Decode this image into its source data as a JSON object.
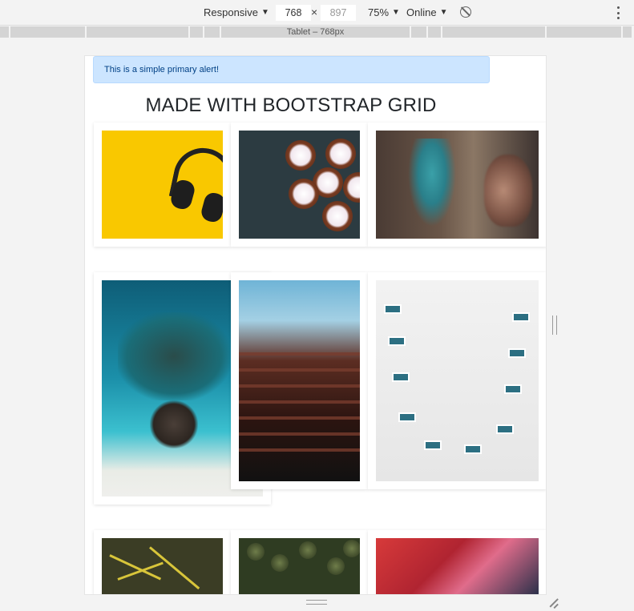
{
  "toolbar": {
    "device": "Responsive",
    "width": "768",
    "height": "897",
    "zoom": "75%",
    "network": "Online"
  },
  "mediaQuery": {
    "label": "Tablet – 768px"
  },
  "page": {
    "alert": "This is a simple primary alert!",
    "heading": "MADE WITH BOOTSTRAP GRID"
  },
  "gallery": [
    {
      "subject": "headphones"
    },
    {
      "subject": "cupcakes"
    },
    {
      "subject": "graffiti"
    },
    {
      "subject": "ocean"
    },
    {
      "subject": "tower"
    },
    {
      "subject": "building"
    },
    {
      "subject": "leaves"
    },
    {
      "subject": "palms"
    },
    {
      "subject": "street-art"
    }
  ],
  "colors": {
    "alert_bg": "#cce5ff",
    "alert_text": "#004085",
    "heading": "#212529"
  }
}
